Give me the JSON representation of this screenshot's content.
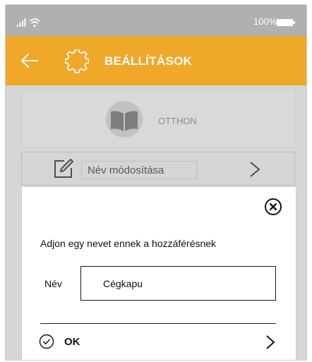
{
  "status_bar": {
    "signal_icon": "signal-wifi-icon",
    "battery_text": "100%",
    "battery_icon": "battery-icon"
  },
  "header": {
    "back_icon": "arrow-left-icon",
    "settings_icon": "gear-icon",
    "title": "BEÁLLÍTÁSOK",
    "background_color": "#efa82a"
  },
  "home_card": {
    "logo_icon": "open-book-icon",
    "label": "OTTHON"
  },
  "rename_row": {
    "icon": "edit-icon",
    "label": "Név módosítása",
    "chevron_icon": "chevron-right-icon"
  },
  "dialog": {
    "close_icon": "close-circle-icon",
    "prompt": "Adjon egy nevet ennek a hozzáférésnek",
    "name_label": "Név",
    "name_value": "Cégkapu",
    "ok_icon": "check-circle-icon",
    "ok_label": "OK",
    "ok_chevron_icon": "chevron-right-icon"
  }
}
